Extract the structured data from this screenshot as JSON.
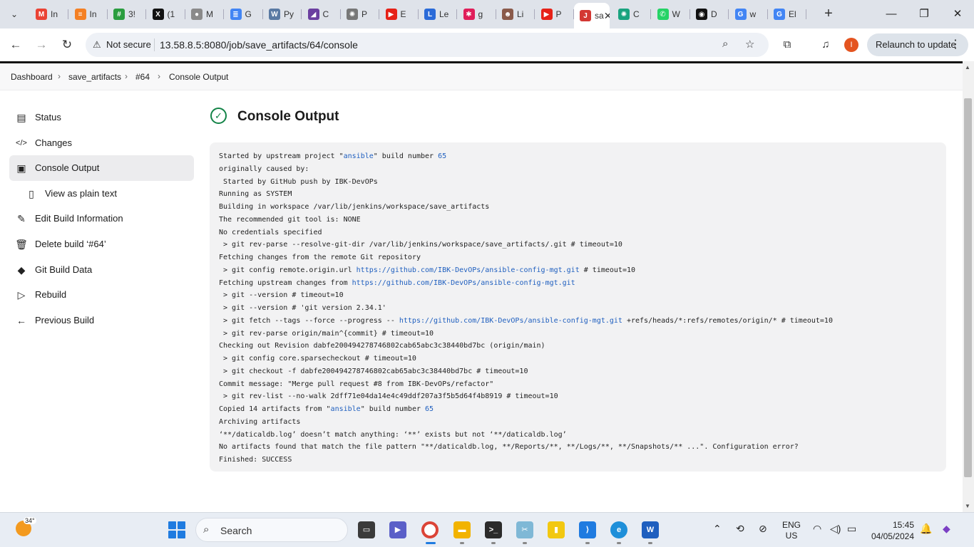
{
  "browser": {
    "tabs": [
      {
        "label": "In",
        "icon": "gmail-icon",
        "color": "#ea4335"
      },
      {
        "label": "In",
        "icon": "stackexchange-icon",
        "color": "#f48024"
      },
      {
        "label": "3!",
        "icon": "hashnode-icon",
        "color": "#2a9d3f"
      },
      {
        "label": "(1",
        "icon": "x-icon",
        "color": "#111111"
      },
      {
        "label": "M",
        "icon": "medium-icon",
        "color": "#8a8a8a"
      },
      {
        "label": "G",
        "icon": "google-docs-icon",
        "color": "#4285f4"
      },
      {
        "label": "Py",
        "icon": "wordpress-icon",
        "color": "#5a7aa3"
      },
      {
        "label": "C",
        "icon": "course-icon",
        "color": "#6b3fa0"
      },
      {
        "label": "P",
        "icon": "chatgpt-icon",
        "color": "#777777"
      },
      {
        "label": "E",
        "icon": "youtube-icon",
        "color": "#e62117"
      },
      {
        "label": "Le",
        "icon": "leetcode-icon",
        "color": "#2a6ad8"
      },
      {
        "label": "g",
        "icon": "slack-icon",
        "color": "#e01e5a"
      },
      {
        "label": "Li",
        "icon": "profile-icon",
        "color": "#8a5a4a"
      },
      {
        "label": "P",
        "icon": "youtube-icon",
        "color": "#e62117"
      },
      {
        "label": "sa",
        "icon": "jenkins-icon",
        "color": "#d33833",
        "active": true
      },
      {
        "label": "C",
        "icon": "chatgpt-icon",
        "color": "#19a37f"
      },
      {
        "label": "W",
        "icon": "whatsapp-icon",
        "color": "#25d366"
      },
      {
        "label": "D",
        "icon": "github-icon",
        "color": "#111111"
      },
      {
        "label": "w",
        "icon": "google-icon",
        "color": "#4285f4"
      },
      {
        "label": "El",
        "icon": "google-icon",
        "color": "#4285f4"
      }
    ],
    "not_secure": "Not secure",
    "url": "13.58.8.5:8080/job/save_artifacts/64/console",
    "relaunch": "Relaunch to update",
    "profile_initial": "I"
  },
  "breadcrumb": [
    "Dashboard",
    "save_artifacts",
    "#64",
    "Console Output"
  ],
  "sidebar": [
    {
      "label": "Status",
      "icon": "document-icon"
    },
    {
      "label": "Changes",
      "icon": "code-icon"
    },
    {
      "label": "Console Output",
      "icon": "terminal-icon",
      "active": true
    },
    {
      "label": "View as plain text",
      "icon": "text-file-icon",
      "sub": true
    },
    {
      "label": "Edit Build Information",
      "icon": "edit-icon"
    },
    {
      "label": "Delete build ‘#64’",
      "icon": "trash-icon"
    },
    {
      "label": "Git Build Data",
      "icon": "git-icon"
    },
    {
      "label": "Rebuild",
      "icon": "play-icon"
    },
    {
      "label": "Previous Build",
      "icon": "arrow-left-icon"
    }
  ],
  "title": "Console Output",
  "console": [
    [
      "Started by upstream project \"",
      {
        "link": "ansible"
      },
      "\" build number ",
      {
        "link": "65"
      }
    ],
    [
      "originally caused by:"
    ],
    [
      " Started by GitHub push by IBK-DevOPs"
    ],
    [
      "Running as SYSTEM"
    ],
    [
      "Building in workspace /var/lib/jenkins/workspace/save_artifacts"
    ],
    [
      "The recommended git tool is: NONE"
    ],
    [
      "No credentials specified"
    ],
    [
      " > git rev-parse --resolve-git-dir /var/lib/jenkins/workspace/save_artifacts/.git # timeout=10"
    ],
    [
      "Fetching changes from the remote Git repository"
    ],
    [
      " > git config remote.origin.url ",
      {
        "link": "https://github.com/IBK-DevOPs/ansible-config-mgt.git"
      },
      " # timeout=10"
    ],
    [
      "Fetching upstream changes from ",
      {
        "link": "https://github.com/IBK-DevOPs/ansible-config-mgt.git"
      }
    ],
    [
      " > git --version # timeout=10"
    ],
    [
      " > git --version # 'git version 2.34.1'"
    ],
    [
      " > git fetch --tags --force --progress -- ",
      {
        "link": "https://github.com/IBK-DevOPs/ansible-config-mgt.git"
      },
      " +refs/heads/*:refs/remotes/origin/* # timeout=10"
    ],
    [
      " > git rev-parse origin/main^{commit} # timeout=10"
    ],
    [
      "Checking out Revision dabfe200494278746802cab65abc3c38440bd7bc (origin/main)"
    ],
    [
      " > git config core.sparsecheckout # timeout=10"
    ],
    [
      " > git checkout -f dabfe200494278746802cab65abc3c38440bd7bc # timeout=10"
    ],
    [
      "Commit message: \"Merge pull request #8 from IBK-DevOPs/refactor\""
    ],
    [
      " > git rev-list --no-walk 2dff71e04da14e4c49ddf207a3f5b5d64f4b8919 # timeout=10"
    ],
    [
      "Copied 14 artifacts from \"",
      {
        "link": "ansible"
      },
      "\" build number ",
      {
        "link": "65"
      }
    ],
    [
      "Archiving artifacts"
    ],
    [
      "‘**/daticaldb.log’ doesn’t match anything: ‘**’ exists but not ‘**/daticaldb.log’"
    ],
    [
      "No artifacts found that match the file pattern \"**/daticaldb.log, **/Reports/**, **/Logs/**, **/Snapshots/** ...\". Configuration error?"
    ],
    [
      "Finished: SUCCESS"
    ]
  ],
  "taskbar": {
    "temperature": "34°",
    "search": "Search",
    "lang_top": "ENG",
    "lang_bottom": "US",
    "time": "15:45",
    "date": "04/05/2024"
  }
}
